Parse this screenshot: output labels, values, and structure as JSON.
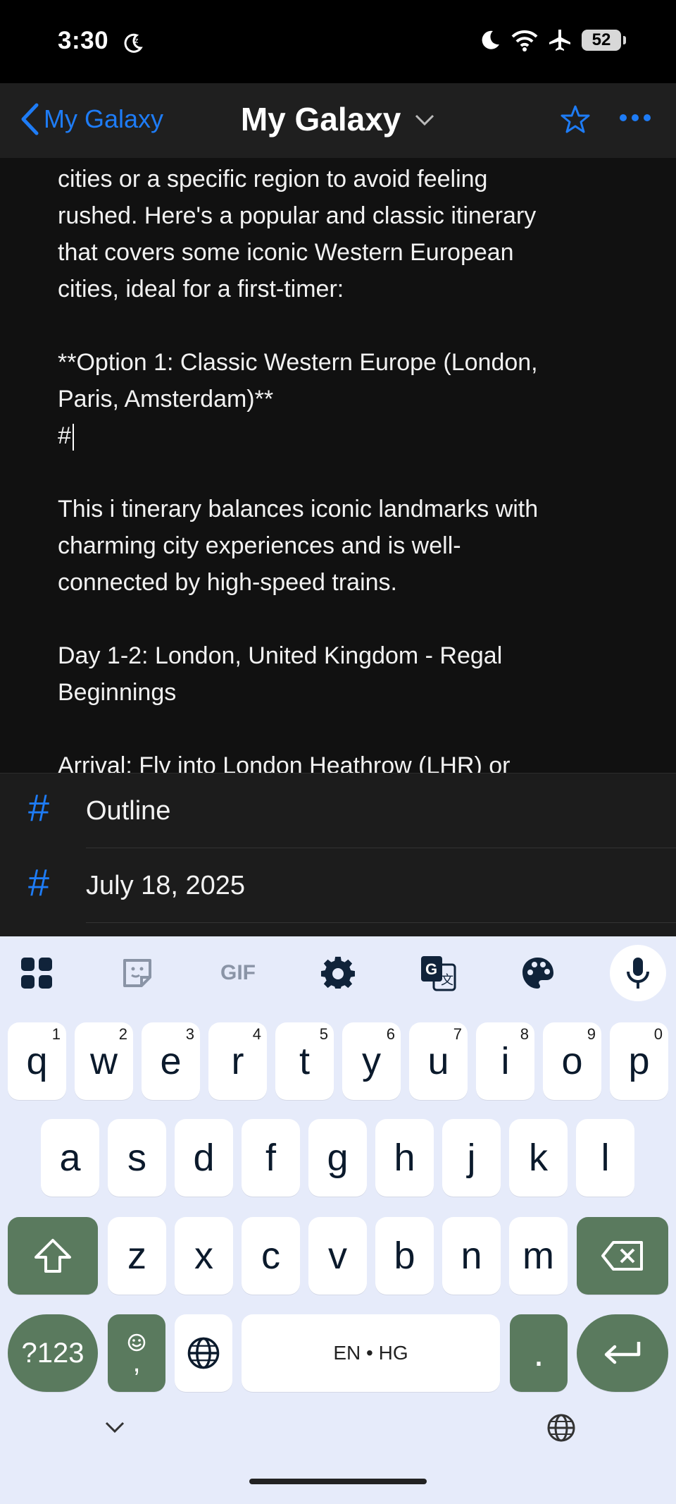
{
  "status_bar": {
    "time": "3:30",
    "battery": "52"
  },
  "navbar": {
    "back_label": "My Galaxy",
    "title": "My Galaxy"
  },
  "note": {
    "lines": [
      "cities or a specific region to avoid feeling",
      "rushed. Here's a popular and classic itinerary",
      "that covers some iconic Western European",
      "cities, ideal for a first-timer:",
      "",
      "**Option 1: Classic Western Europe (London,",
      "Paris, Amsterdam)**",
      "#",
      "",
      "This i tinerary balances iconic landmarks with",
      "charming city experiences and is well-",
      "connected by high-speed trains.",
      "",
      "Day 1-2: London, United Kingdom - Regal",
      "Beginnings",
      "",
      "Arrival: Fly into London Heathrow (LHR) or"
    ]
  },
  "tag_suggestions": [
    {
      "symbol": "#",
      "label": "Outline"
    },
    {
      "symbol": "#",
      "label": "July 18, 2025"
    }
  ],
  "keyboard": {
    "toolbar": {
      "gif_label": "GIF"
    },
    "row1": [
      {
        "key": "q",
        "hint": "1"
      },
      {
        "key": "w",
        "hint": "2"
      },
      {
        "key": "e",
        "hint": "3"
      },
      {
        "key": "r",
        "hint": "4"
      },
      {
        "key": "t",
        "hint": "5"
      },
      {
        "key": "y",
        "hint": "6"
      },
      {
        "key": "u",
        "hint": "7"
      },
      {
        "key": "i",
        "hint": "8"
      },
      {
        "key": "o",
        "hint": "9"
      },
      {
        "key": "p",
        "hint": "0"
      }
    ],
    "row2": [
      "a",
      "s",
      "d",
      "f",
      "g",
      "h",
      "j",
      "k",
      "l"
    ],
    "row3": [
      "z",
      "x",
      "c",
      "v",
      "b",
      "n",
      "m"
    ],
    "symbols_label": "?123",
    "comma_label": ",",
    "space_label": "EN • HG",
    "period_label": "."
  },
  "colors": {
    "accent": "#1e7cf6",
    "key_dark": "#5a7a5e",
    "keyboard_bg": "#e6ebfa"
  }
}
